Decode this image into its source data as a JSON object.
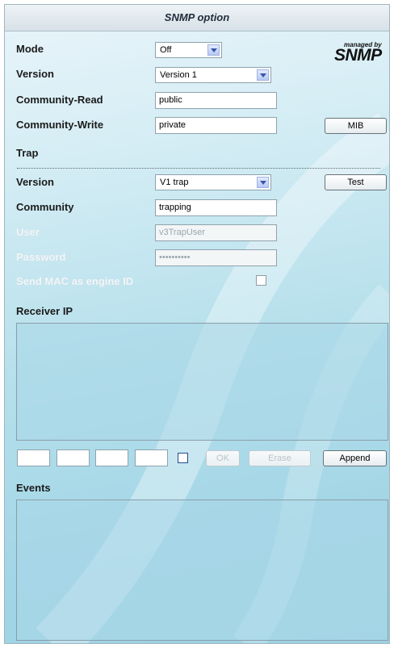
{
  "title": "SNMP option",
  "logo": {
    "small": "managed by",
    "big": "SNMP"
  },
  "mode": {
    "label": "Mode",
    "value": "Off"
  },
  "version": {
    "label": "Version",
    "value": "Version 1"
  },
  "community_read": {
    "label": "Community-Read",
    "value": "public"
  },
  "community_write": {
    "label": "Community-Write",
    "value": "private"
  },
  "mib_button": "MIB",
  "trap": {
    "section_label": "Trap",
    "version_label": "Version",
    "version_value": "V1 trap",
    "test_button": "Test",
    "community_label": "Community",
    "community_value": "trapping",
    "user_label": "User",
    "user_value": "v3TrapUser",
    "password_label": "Password",
    "password_value": "••••••••••",
    "send_mac_label": "Send MAC as engine ID",
    "send_mac_checked": false
  },
  "receiver": {
    "label": "Receiver IP",
    "ip_octets": [
      "",
      "",
      "",
      ""
    ],
    "checked": false,
    "ok_button": "OK",
    "erase_button": "Erase",
    "append_button": "Append"
  },
  "events": {
    "label": "Events"
  },
  "colors": {
    "panel_top": "#e9f5fa",
    "panel_bottom": "#9cd3e4",
    "disabled_label": "#f2f6f8"
  }
}
